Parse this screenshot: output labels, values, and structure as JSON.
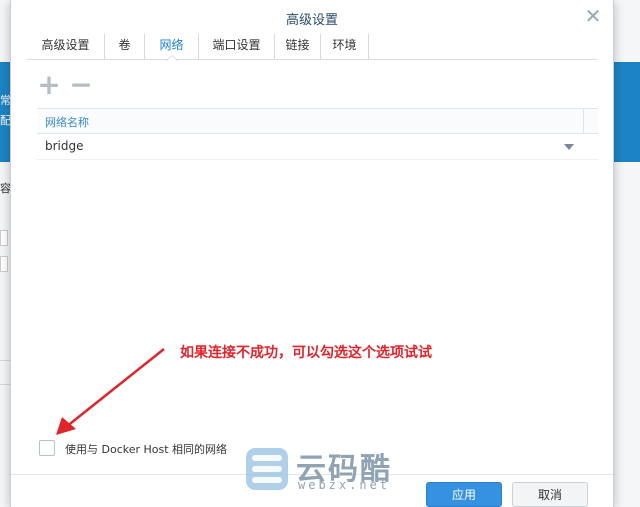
{
  "dialog": {
    "title": "高级设置",
    "close_glyph": "✕"
  },
  "tabs": [
    {
      "label": "高级设置",
      "active": false
    },
    {
      "label": "卷",
      "active": false
    },
    {
      "label": "网络",
      "active": true
    },
    {
      "label": "端口设置",
      "active": false
    },
    {
      "label": "链接",
      "active": false
    },
    {
      "label": "环境",
      "active": false
    }
  ],
  "toolbar": {
    "add_glyph": "+",
    "remove_glyph": "−"
  },
  "network_table": {
    "column_header": "网络名称",
    "rows": [
      {
        "name": "bridge"
      }
    ]
  },
  "annotation": {
    "text": "如果连接不成功，可以勾选这个选项试试",
    "color": "#e0242b"
  },
  "option": {
    "label": "使用与 Docker Host 相同的网络",
    "checked": false
  },
  "buttons": {
    "apply": "应用",
    "cancel": "取消"
  },
  "background": {
    "left_glyph_1": "常",
    "left_glyph_2": "配",
    "left_glyph_3": "容"
  },
  "watermark": {
    "name": "云码酷",
    "site": "webzx.net"
  },
  "colors": {
    "accent": "#1a7fd4",
    "apply_button": "#3592e0",
    "header_band": "#1c84c6"
  }
}
